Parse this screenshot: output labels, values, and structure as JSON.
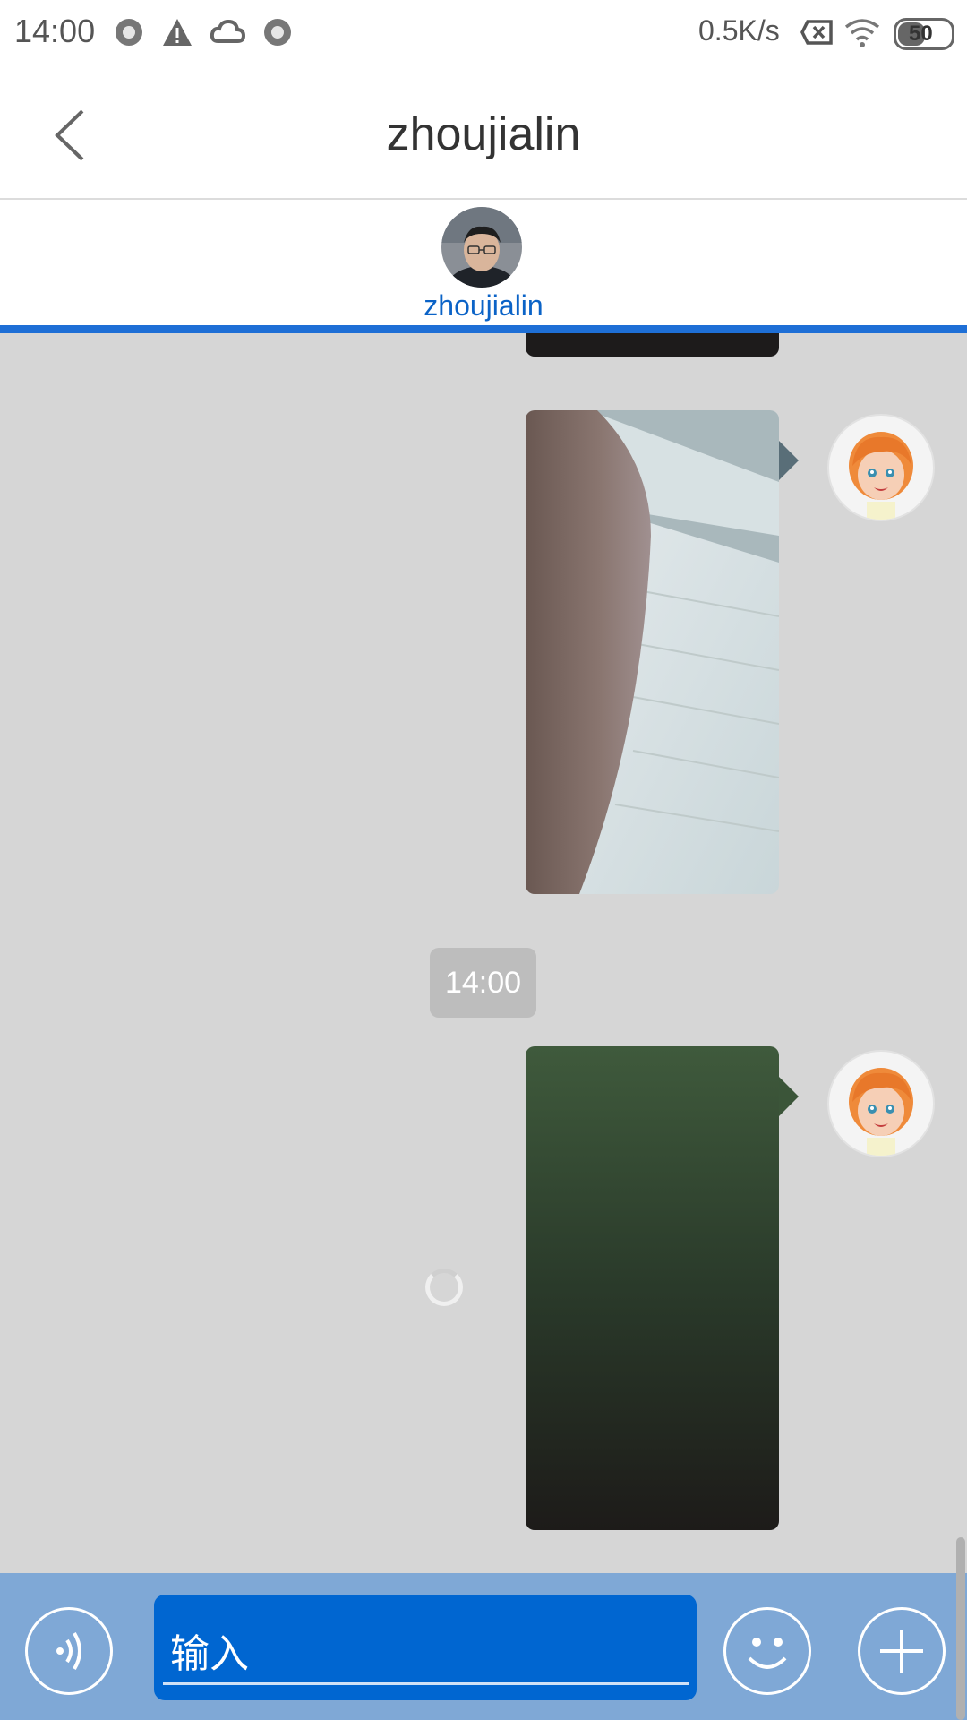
{
  "status_bar": {
    "time": "14:00",
    "speed": "0.5K/s",
    "battery": "50",
    "icons": [
      "circle-icon",
      "warning-icon",
      "cloud-icon",
      "circle-icon",
      "sim-x-icon",
      "wifi-icon",
      "battery-icon"
    ]
  },
  "header": {
    "title": "zhoujialin",
    "back_icon": "chevron-left-icon"
  },
  "contact": {
    "name": "zhoujialin"
  },
  "chat": {
    "timestamp": "14:00",
    "messages": [
      {
        "type": "image",
        "from": "self",
        "description_icon": "photo-image"
      },
      {
        "type": "image",
        "from": "self",
        "description_icon": "photo-image"
      }
    ]
  },
  "input_bar": {
    "placeholder": "输入",
    "voice_icon": "voice-icon",
    "emoji_icon": "emoji-icon",
    "plus_icon": "plus-icon"
  },
  "colors": {
    "accent": "#1e6fd6",
    "input_bg": "#0066d1",
    "bottom_bar": "#7fa8d6",
    "chat_bg": "#d6d6d6"
  }
}
